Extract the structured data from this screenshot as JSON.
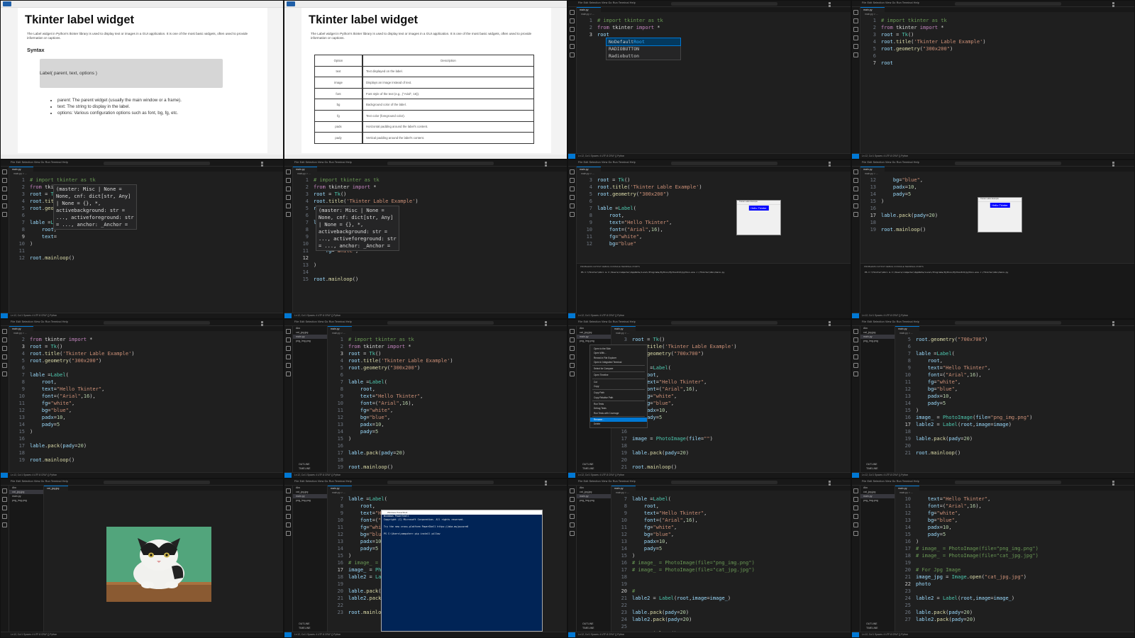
{
  "doc_slide_1": {
    "title": "Tkinter label widget",
    "description": "The Label widget in Python's tkinter library is used to display text or images in a GUI application. It is one of the most basic widgets, often used to provide information or captions.",
    "syntax_heading": "Syntax",
    "syntax_code": "Label( parent,  text,  options )",
    "bullets": [
      "parent: The parent widget (usually the main window or a frame).",
      "text: The string to display in the label.",
      "options: Various configuration options such as font, bg, fg, etc."
    ]
  },
  "doc_slide_2": {
    "title": "Tkinter label widget",
    "description": "The Label widget in Python's tkinter library is used to display text or images in a GUI application. It is one of the most basic widgets, often used to provide information or captions.",
    "table_headers": [
      "Option",
      "Description"
    ],
    "table_rows": [
      [
        "text",
        "Text displayed on the label."
      ],
      [
        "image",
        "Displays an image instead of text."
      ],
      [
        "font",
        "Font style of the text (e.g., (\"Arial\", 16))."
      ],
      [
        "bg",
        "Background color of the label."
      ],
      [
        "fg",
        "Text color (foreground color)."
      ],
      [
        "padx",
        "Horizontal padding around the label's content."
      ],
      [
        "pady",
        "Vertical padding around the label's content."
      ]
    ]
  },
  "vscode": {
    "menu": "File  Edit  Selection  View  Go  Run  Terminal  Help",
    "tab": "main.py",
    "crumb": "main.py > ...",
    "explorer_items": [
      "Abc",
      "cat_jpg.jpg",
      "main.py",
      "png_img.png"
    ],
    "explorer_footer": [
      "OUTLINE",
      "TIMELINE"
    ],
    "panel_tabs": "PROBLEMS   OUTPUT   DEBUG CONSOLE   TERMINAL   PORTS",
    "terminal_line": "PS C:\\Tkinter\\Abc> & C:/Users/computer/AppData/Local/Programs/Python/Python313/python.exe c:/Tkinter/Abc/main.py",
    "status": "Ln 12, Col 1   Spaces: 4   UTF-8   CRLF   {} Python"
  },
  "tk_window": {
    "title": "Tkinter Lable Example",
    "label": "Hello Tkinter"
  },
  "autocomplete": [
    "NoDefaultRoot",
    "RADIOBUTTON",
    "Radiobutton"
  ],
  "hover_signature": "(master: Misc | None =\nNone, cnf: dict[str, Any]\n| None = {}, *,\nactivebackground: str =\n..., activeforeground: str\n= ..., anchor: _Anchor =",
  "context_menu": [
    "Open to the Side",
    "Open With...",
    "Reveal in File Explorer",
    "Open in Integrated Terminal",
    "-",
    "Select for Compare",
    "-",
    "Open Timeline",
    "-",
    "Cut",
    "Copy",
    "-",
    "Copy Path",
    "Copy Relative Path",
    "-",
    "Run Tests",
    "Debug Tests",
    "Run Tests with Coverage",
    "-",
    "Rename...",
    "Delete"
  ],
  "powershell": {
    "title": "Windows PowerShell",
    "lines": [
      "Windows PowerShell",
      "Copyright (C) Microsoft Corporation. All rights reserved.",
      "",
      "Try the new cross-platform PowerShell https://aka.ms/pscore6",
      "",
      "PS C:\\Users\\computer> pip install pillow"
    ]
  },
  "code_tiles": [
    {
      "start": 1,
      "current": 3,
      "lines": [
        "# import tkinter as tk",
        "from tkinter import *",
        "root"
      ]
    },
    {
      "start": 1,
      "current": 7,
      "lines": [
        "# import tkinter as tk",
        "from tkinter import *",
        "root = Tk()",
        "root.title('Tkinter Lable Example')",
        "root.geometry(\"300x200\")",
        "",
        "root"
      ]
    },
    {
      "start": 1,
      "current": 9,
      "lines": [
        "# import tkinter as tk",
        "from tkinter import *",
        "root = Tk()",
        "root.title('Tkinter Lable Example')",
        "root.geometry(\"300x200\")",
        "",
        "lable =Label(",
        "    root,",
        "    text=",
        ")",
        "",
        "root.mainloop()"
      ]
    },
    {
      "start": 1,
      "current": 12,
      "lines": [
        "# import tkinter as tk",
        "from tkinter import *",
        "root = Tk()",
        "root.title('Tkinter Lable Example')",
        "root.geometry(\"300x200\")",
        "",
        "lable =Label(",
        "    root,",
        "    text=\"Hello Tkinter\",",
        "    font=(\"Arial\",16),",
        "    fg=\"white\",",
        "    ",
        ")",
        "",
        "root.mainloop()"
      ]
    },
    {
      "start": 3,
      "current": 0,
      "lines": [
        "root = Tk()",
        "root.title('Tkinter Lable Example')",
        "root.geometry(\"300x200\")",
        "",
        "lable =Label(",
        "    root,",
        "    text=\"Hello Tkinter\",",
        "    font=(\"Arial\",16),",
        "    fg=\"white\",",
        "    bg=\"blue\""
      ]
    },
    {
      "start": 12,
      "current": 17,
      "lines": [
        "    bg=\"blue\",",
        "    padx=10,",
        "    pady=5",
        ")",
        "",
        "lable.pack(pady=20)",
        "",
        "root.mainloop()"
      ]
    },
    {
      "start": 2,
      "current": 3,
      "lines": [
        "from tkinter import *",
        "root = Tk()",
        "root.title('Tkinter Lable Example')",
        "root.geometry(\"300x200\")",
        "",
        "lable =Label(",
        "    root,",
        "    text=\"Hello Tkinter\",",
        "    font=(\"Arial\",16),",
        "    fg=\"white\",",
        "    bg=\"blue\",",
        "    padx=10,",
        "    pady=5",
        ")",
        "",
        "lable.pack(pady=20)",
        "",
        "root.mainloop()"
      ]
    },
    {
      "start": 1,
      "current": 3,
      "lines": [
        "# import tkinter as tk",
        "from tkinter import *",
        "root = Tk()",
        "root.title('Tkinter Lable Example')",
        "root.geometry(\"300x200\")",
        "",
        "lable =Label(",
        "    root,",
        "    text=\"Hello Tkinter\",",
        "    font=(\"Arial\",16),",
        "    fg=\"white\",",
        "    bg=\"blue\",",
        "    padx=10,",
        "    pady=5",
        ")",
        "",
        "lable.pack(pady=20)",
        "",
        "root.mainloop()"
      ]
    },
    {
      "start": 3,
      "current": 0,
      "lines": [
        "root = Tk()",
        "root.title('Tkinter Lable Example')",
        "root.geometry(\"700x700\")",
        "",
        "lable =Label(",
        "    root,",
        "    text=\"Hello Tkinter\",",
        "    font=(\"Arial\",16),",
        "    fg=\"white\",",
        "    bg=\"blue\",",
        "    padx=10,",
        "    pady=5",
        ")",
        "",
        "image = PhotoImage(file=\"\")",
        "",
        "lable.pack(pady=20)",
        "",
        "root.mainloop()"
      ]
    },
    {
      "start": 5,
      "current": 17,
      "lines": [
        "root.geometry(\"700x700\")",
        "",
        "lable =Label(",
        "    root,",
        "    text=\"Hello Tkinter\",",
        "    font=(\"Arial\",16),",
        "    fg=\"white\",",
        "    bg=\"blue\",",
        "    padx=10,",
        "    pady=5",
        ")",
        "image_ = PhotoImage(file=\"png_img.png\")",
        "lable2 = Label(root,image=image)",
        "",
        "lable.pack(pady=20)",
        "",
        "root.mainloop()"
      ]
    },
    {
      "start": 7,
      "current": 17,
      "lines": [
        "lable =Label(",
        "    root,",
        "    text=\"Hello Tkinter\",",
        "    font=(\"Arial\",16),",
        "    fg=\"white\",",
        "    bg=\"blue\",",
        "    padx=10,",
        "    pady=5",
        ")",
        "# image_ = PhotoImage(file=\"png_img.png\")",
        "image_ = PhotoImage(file=\"cat_jpg.jpg\")",
        "lable2 = Label(root,image=image_)",
        "",
        "lable.pack(pady=20)",
        "lable2.pack(pady=20)",
        "",
        "root.mainloop()"
      ]
    },
    {
      "start": 7,
      "current": 20,
      "lines": [
        "lable =Label(",
        "    root,",
        "    text=\"Hello Tkinter\",",
        "    font=(\"Arial\",16),",
        "    fg=\"white\",",
        "    bg=\"blue\",",
        "    padx=10,",
        "    pady=5",
        ")",
        "# image_ = PhotoImage(file=\"png_img.png\")",
        "# image_ = PhotoImage(file=\"cat_jpg.jpg\")",
        "",
        "",
        "#",
        "lable2 = Label(root,image=image_)",
        "",
        "lable.pack(pady=20)",
        "lable2.pack(pady=20)",
        "",
        "root.mainloop()"
      ]
    },
    {
      "start": 10,
      "current": 22,
      "lines": [
        "    text=\"Hello Tkinter\",",
        "    font=(\"Arial\",16),",
        "    fg=\"white\",",
        "    bg=\"blue\",",
        "    padx=10,",
        "    pady=5",
        ")",
        "# image_ = PhotoImage(file=\"png_img.png\")",
        "# image_ = PhotoImage(file=\"cat_jpg.jpg\")",
        "",
        "# For Jpg Image",
        "image_jpg = Image.open(\"cat_jpg.jpg\")",
        "photo",
        "",
        "lable2 = Label(root,image=image_)",
        "",
        "lable.pack(pady=20)",
        "lable2.pack(pady=20)"
      ]
    }
  ]
}
